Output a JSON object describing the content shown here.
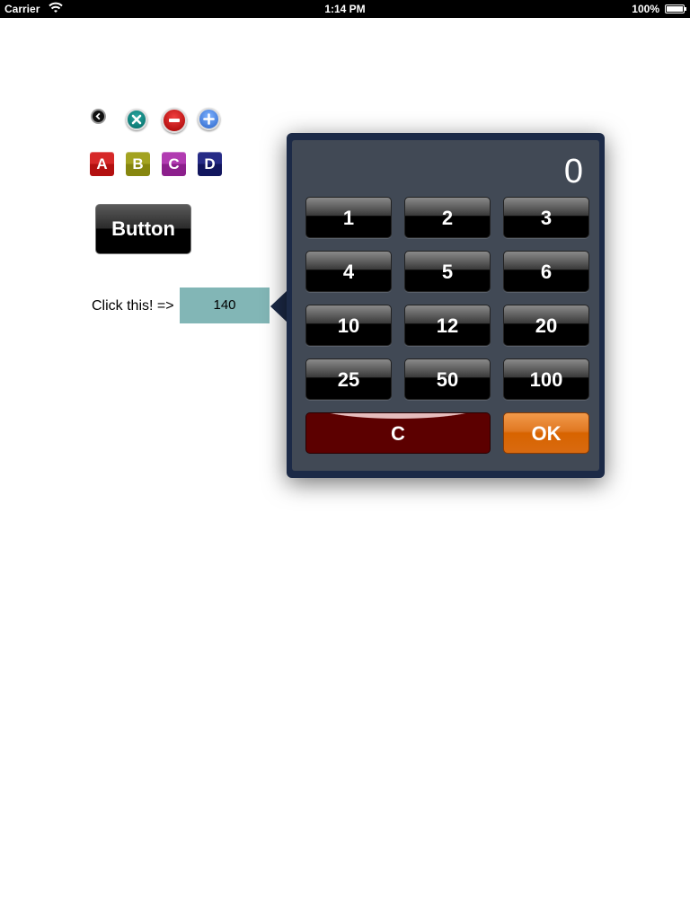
{
  "status_bar": {
    "carrier": "Carrier",
    "time": "1:14 PM",
    "battery": "100%"
  },
  "icons": [
    {
      "name": "back-icon",
      "color": "#111111"
    },
    {
      "name": "close-icon",
      "color": "#0a8a84"
    },
    {
      "name": "minus-icon",
      "color": "#cc1010"
    },
    {
      "name": "plus-icon",
      "color": "#4a86e8"
    }
  ],
  "tiles": [
    {
      "label": "A",
      "color": "#c41c1c"
    },
    {
      "label": "B",
      "color": "#959518"
    },
    {
      "label": "C",
      "color": "#9e2a9e"
    },
    {
      "label": "D",
      "color": "#1a1f72"
    }
  ],
  "main_button": {
    "label": "Button"
  },
  "picker": {
    "prompt": "Click this! =>",
    "value": "140"
  },
  "keypad": {
    "display": "0",
    "keys": [
      "1",
      "2",
      "3",
      "4",
      "5",
      "6",
      "10",
      "12",
      "20",
      "25",
      "50",
      "100"
    ],
    "clear_label": "C",
    "ok_label": "OK"
  },
  "colors": {
    "popover_border": "#1c2a47",
    "popover_body": "#414955",
    "value_field": "#82b6b6",
    "clear_key": "#5c0000",
    "ok_key": "#e07822"
  }
}
